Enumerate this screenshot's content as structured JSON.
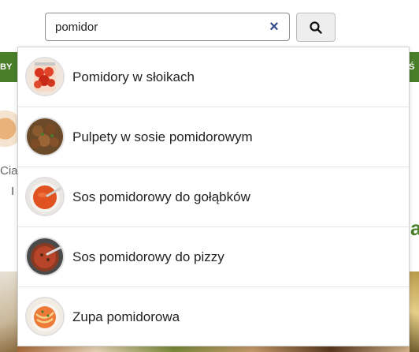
{
  "background": {
    "left_banner_text": "BY",
    "right_banner_text": "Ś",
    "card_title_fragment": "Cia",
    "card_sub_fragment": "I",
    "right_heading_fragment": "a"
  },
  "search": {
    "value": "pomidor",
    "clear_icon": "×",
    "button_icon": "search-icon"
  },
  "suggestions": [
    {
      "label": "Pomidory w słoikach",
      "thumb": "tomatoes-in-jar"
    },
    {
      "label": "Pulpety w sosie pomidorowym",
      "thumb": "meatballs-in-sauce"
    },
    {
      "label": "Sos pomidorowy do gołąbków",
      "thumb": "tomato-sauce-bowl"
    },
    {
      "label": "Sos pomidorowy do pizzy",
      "thumb": "pizza-sauce-bowl"
    },
    {
      "label": "Zupa pomidorowa",
      "thumb": "tomato-soup"
    }
  ],
  "colors": {
    "brand_green": "#4a7f2a",
    "clear_icon": "#2f4a8a"
  }
}
